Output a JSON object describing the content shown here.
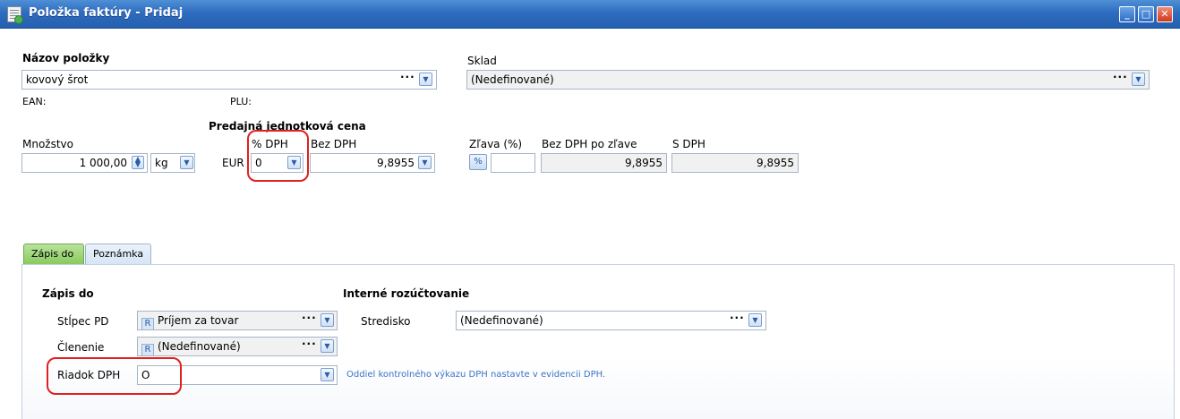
{
  "window": {
    "title": "Položka faktúry - Pridaj"
  },
  "item": {
    "name_label": "Názov položky",
    "name_value": "kovový šrot",
    "ean_label": "EAN:",
    "plu_label": "PLU:"
  },
  "warehouse": {
    "label": "Sklad",
    "value": "(Nedefinované)"
  },
  "price": {
    "section_label": "Predajná jednotková cena",
    "quantity_label": "Množstvo",
    "quantity_value": "1 000,00",
    "unit_value": "kg",
    "currency": "EUR",
    "vat_label": "% DPH",
    "vat_value": "0",
    "net_label": "Bez DPH",
    "net_value": "9,8955",
    "discount_label": "Zľava (%)",
    "discount_button": "%",
    "discount_value": "",
    "after_discount_label": "Bez DPH po zľave",
    "after_discount_value": "9,8955",
    "gross_label": "S DPH",
    "gross_value": "9,8955"
  },
  "tabs": [
    {
      "label": "Zápis do"
    },
    {
      "label": "Poznámka"
    }
  ],
  "entry": {
    "heading": "Zápis do",
    "column_label": "Stĺpec PD",
    "column_tag": "R",
    "column_value": "Príjem za tovar",
    "division_label": "Členenie",
    "division_tag": "R",
    "division_value": "(Nedefinované)",
    "vat_row_label": "Riadok DPH",
    "vat_row_value": "O",
    "vat_row_hint": "Oddiel kontrolného výkazu DPH nastavte v evidencii DPH."
  },
  "internal": {
    "heading": "Interné rozúčtovanie",
    "center_label": "Stredisko",
    "center_value": "(Nedefinované)"
  },
  "icons": {
    "dropdown": "chevron-down-icon",
    "lookup": "ellipsis-icon",
    "spin": "spinner-icon",
    "window": "document-icon"
  },
  "colors": {
    "titlebar": "#2f6cbf",
    "active_tab": "#86c95b",
    "highlight": "#e02020",
    "hint": "#3b73c6"
  }
}
